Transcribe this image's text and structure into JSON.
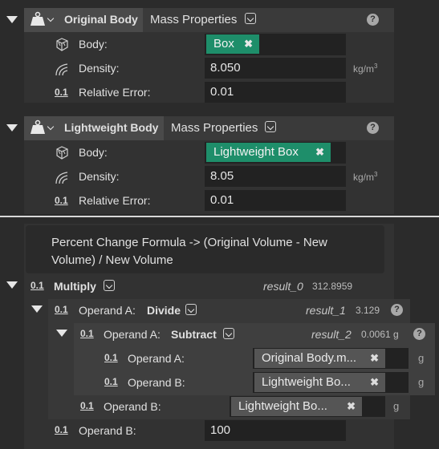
{
  "block1": {
    "name": "Original Body",
    "type": "Mass Properties",
    "help": "?",
    "rows": [
      {
        "label": "Body:",
        "tag": "Box",
        "tag_close": "✖"
      },
      {
        "label": "Density:",
        "value": "8.050",
        "unit": "kg/m",
        "unit_sup": "3"
      },
      {
        "label": "Relative Error:",
        "value": "0.01"
      }
    ]
  },
  "block2": {
    "name": "Lightweight Body",
    "type": "Mass Properties",
    "help": "?",
    "rows": [
      {
        "label": "Body:",
        "tag": "Lightweight Box",
        "tag_close": "✖"
      },
      {
        "label": "Density:",
        "value": "8.05",
        "unit": "kg/m",
        "unit_sup": "3"
      },
      {
        "label": "Relative Error:",
        "value": "0.01"
      }
    ]
  },
  "formula": {
    "comment": "Percent Change Formula -> (Original Volume - New Volume) / New Volume",
    "type_badge": "0.1",
    "multiply": {
      "label": "Multiply",
      "result_name": "result_0",
      "result_value": "312.8959"
    },
    "operand_a": {
      "prefix": "Operand A:",
      "op": "Divide",
      "result_name": "result_1",
      "result_value": "3.129",
      "help": "?"
    },
    "operand_a2": {
      "prefix": "Operand A:",
      "op": "Subtract",
      "result_name": "result_2",
      "result_value": "0.0061 g",
      "help": "?"
    },
    "sub_a": {
      "label": "Operand A:",
      "value": "Original Body.m...",
      "close": "✖",
      "unit": "g"
    },
    "sub_b": {
      "label": "Operand B:",
      "value": "Lightweight Bo...",
      "close": "✖",
      "unit": "g"
    },
    "div_b": {
      "label": "Operand B:",
      "value": "Lightweight Bo...",
      "close": "✖",
      "unit": "g"
    },
    "mul_b": {
      "label": "Operand B:",
      "value": "100"
    }
  }
}
